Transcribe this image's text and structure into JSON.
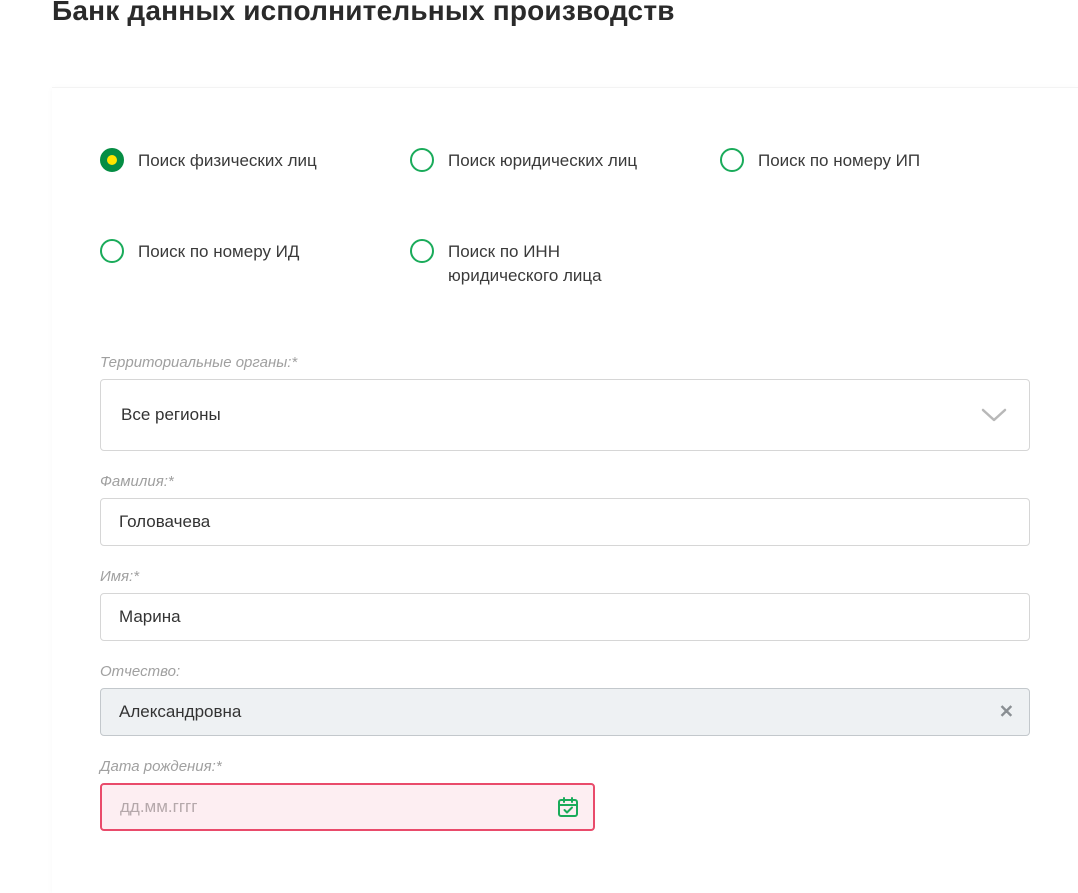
{
  "title": "Банк данных исполнительных производств",
  "radios": {
    "opt0": "Поиск физических лиц",
    "opt1": "Поиск юридических лиц",
    "opt2": "Поиск по номеру ИП",
    "opt3": "Поиск по номеру ИД",
    "opt4": "Поиск по ИНН юридического лица"
  },
  "form": {
    "region_label": "Территориальные органы:*",
    "region_value": "Все регионы",
    "lastname_label": "Фамилия:*",
    "lastname_value": "Головачева",
    "firstname_label": "Имя:*",
    "firstname_value": "Марина",
    "middlename_label": "Отчество:",
    "middlename_value": "Александровна",
    "birthdate_label": "Дата рождения:*",
    "birthdate_placeholder": "дд.мм.гггг"
  }
}
